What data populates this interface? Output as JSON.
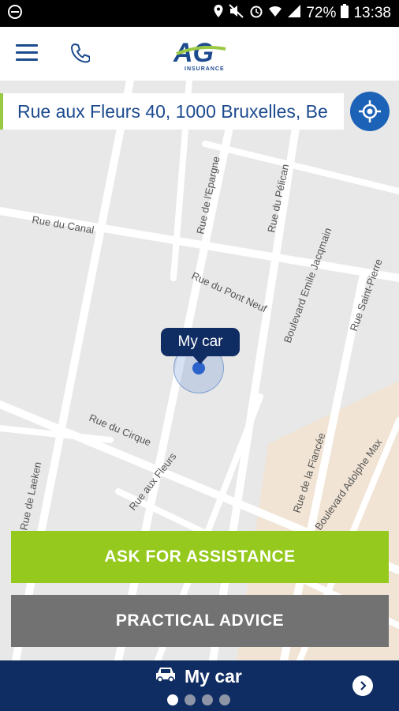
{
  "status_bar": {
    "battery_percent": "72%",
    "time": "13:38"
  },
  "app_bar": {
    "logo_text": "AG",
    "logo_subtext": "INSURANCE"
  },
  "map": {
    "streets": [
      "Rue du Canal",
      "Rue de l'Epargne",
      "Rue du Pélican",
      "Rue du Pont Neuf",
      "Boulevard Emile Jacqmain",
      "Rue Saint-Pierre",
      "Rue du Cirque",
      "Rue aux Fleurs",
      "Rue de Laeken",
      "Rue de la Fiancée",
      "Boulevard Adolphe Max"
    ]
  },
  "address_field": {
    "value": "Rue aux Fleurs 40, 1000 Bruxelles, Be"
  },
  "marker": {
    "label": "My car"
  },
  "buttons": {
    "ask_assistance": "ASK FOR ASSISTANCE",
    "practical_advice": "PRACTICAL ADVICE"
  },
  "bottom_bar": {
    "title": "My car",
    "pages": 4,
    "active_page": 1
  },
  "colors": {
    "brand_navy": "#0f2d63",
    "brand_blue": "#1c63b7",
    "assist_green": "#95c91d",
    "advice_gray": "#727272"
  }
}
